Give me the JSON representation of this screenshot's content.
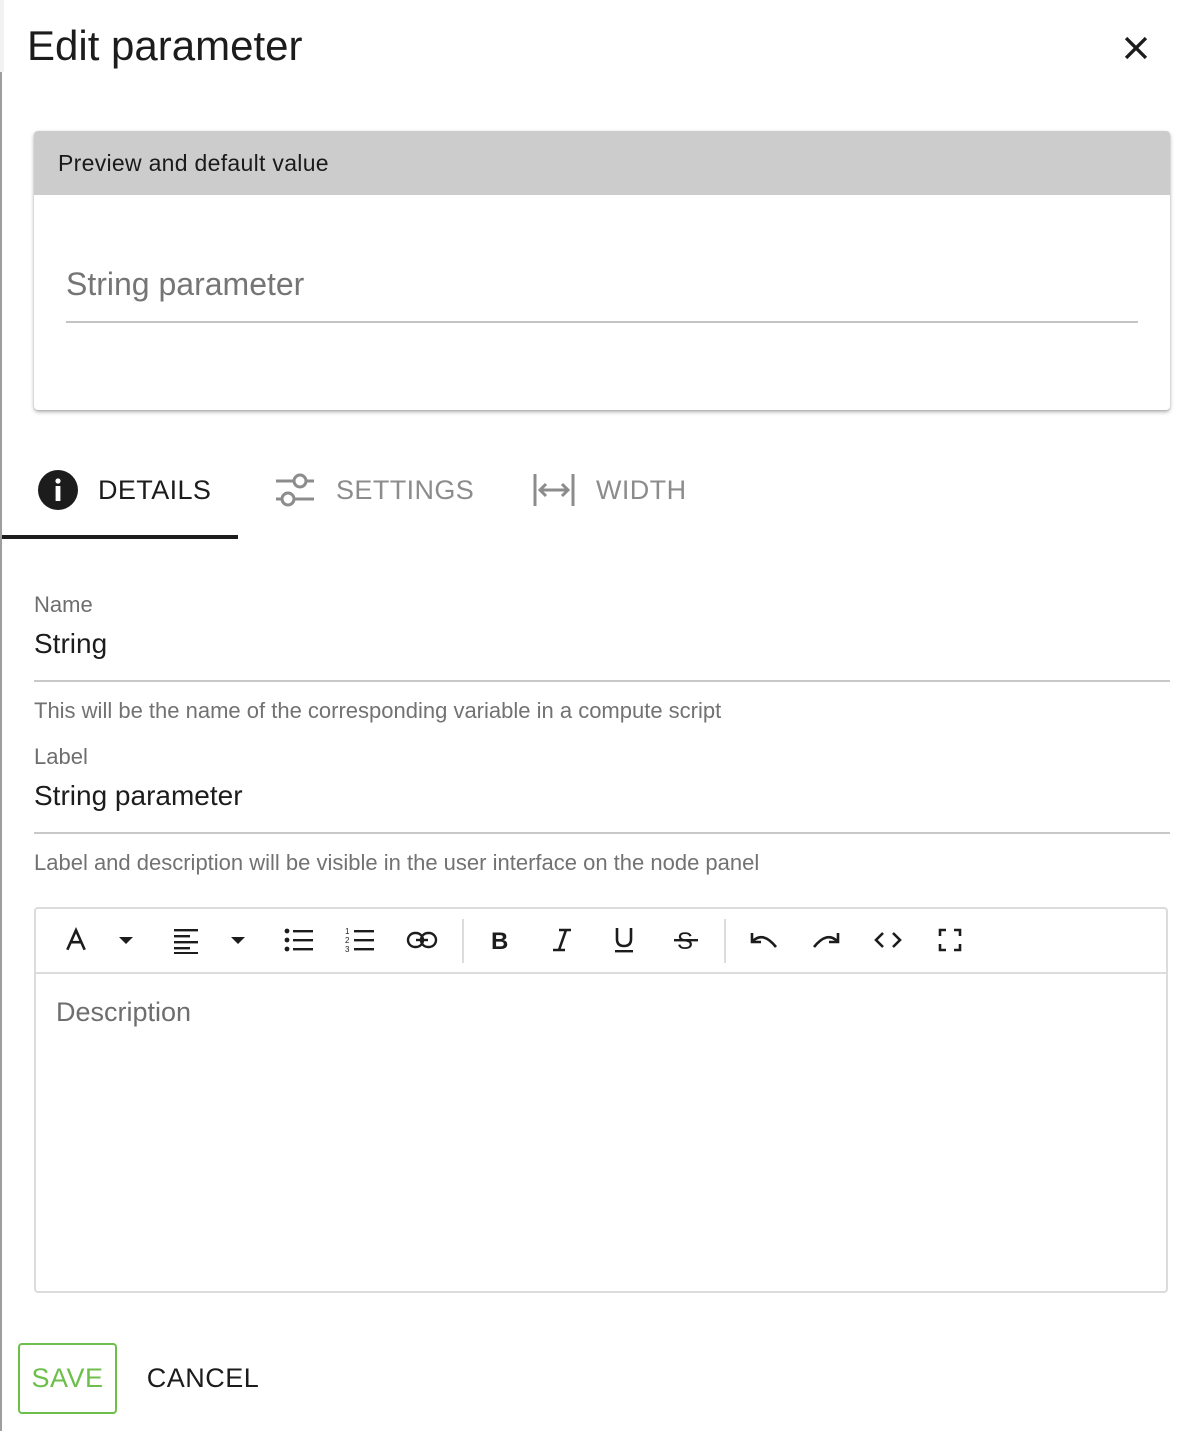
{
  "dialog": {
    "title": "Edit parameter",
    "close_icon": "close-icon"
  },
  "preview": {
    "header": "Preview and default value",
    "input_placeholder": "String parameter",
    "input_value": ""
  },
  "tabs": [
    {
      "label": "DETAILS",
      "icon": "info-icon",
      "active": true
    },
    {
      "label": "SETTINGS",
      "icon": "sliders-icon",
      "active": false
    },
    {
      "label": "WIDTH",
      "icon": "width-icon",
      "active": false
    }
  ],
  "details": {
    "name": {
      "label": "Name",
      "value": "String",
      "hint": "This will be the name of the corresponding variable in a compute script"
    },
    "label": {
      "label": "Label",
      "value": "String parameter",
      "hint": "Label and description will be visible in the user interface on the node panel"
    },
    "description": {
      "placeholder": "Description",
      "toolbar": [
        "font-color-icon",
        "dropdown-icon",
        "align-left-icon",
        "dropdown-icon",
        "bullet-list-icon",
        "numbered-list-icon",
        "link-icon",
        "bold-icon",
        "italic-icon",
        "underline-icon",
        "strikethrough-icon",
        "undo-icon",
        "redo-icon",
        "code-icon",
        "fullscreen-icon"
      ]
    }
  },
  "actions": {
    "save_label": "SAVE",
    "cancel_label": "CANCEL"
  },
  "colors": {
    "accent": "#6cc04a",
    "header_bg": "#cccccc",
    "text": "#1c1c1c",
    "muted": "#8c8c8c"
  }
}
